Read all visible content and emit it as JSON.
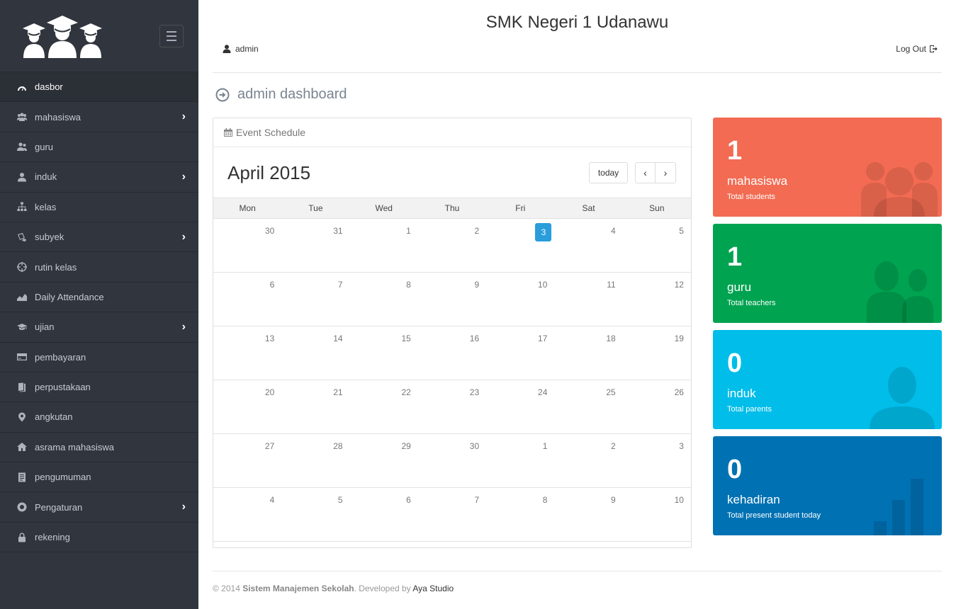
{
  "sidebar": {
    "items": [
      {
        "label": "dasbor",
        "icon": "dashboard-icon",
        "chevron": false,
        "active": true
      },
      {
        "label": "mahasiswa",
        "icon": "students-icon",
        "chevron": true
      },
      {
        "label": "guru",
        "icon": "teacher-icon",
        "chevron": false
      },
      {
        "label": "induk",
        "icon": "user-icon",
        "chevron": true
      },
      {
        "label": "kelas",
        "icon": "sitemap-icon",
        "chevron": false
      },
      {
        "label": "subyek",
        "icon": "book-tag-icon",
        "chevron": true
      },
      {
        "label": "rutin kelas",
        "icon": "crosshair-icon",
        "chevron": false
      },
      {
        "label": "Daily Attendance",
        "icon": "area-chart-icon",
        "chevron": false
      },
      {
        "label": "ujian",
        "icon": "graduation-cap-icon",
        "chevron": true
      },
      {
        "label": "pembayaran",
        "icon": "credit-card-icon",
        "chevron": false
      },
      {
        "label": "perpustakaan",
        "icon": "book-icon",
        "chevron": false
      },
      {
        "label": "angkutan",
        "icon": "map-marker-icon",
        "chevron": false
      },
      {
        "label": "asrama mahasiswa",
        "icon": "home-icon",
        "chevron": false
      },
      {
        "label": "pengumuman",
        "icon": "list-doc-icon",
        "chevron": false
      },
      {
        "label": "Pengaturan",
        "icon": "lifebuoy-icon",
        "chevron": true
      },
      {
        "label": "rekening",
        "icon": "lock-icon",
        "chevron": false
      }
    ],
    "chevron_glyph": "›"
  },
  "header": {
    "site_title": "SMK Negeri 1 Udanawu",
    "user": "admin",
    "logout": "Log Out"
  },
  "page": {
    "heading": "admin dashboard"
  },
  "calendar": {
    "panel_title": "Event Schedule",
    "month": "April 2015",
    "today_label": "today",
    "prev_label": "‹",
    "next_label": "›",
    "weekdays": [
      "Mon",
      "Tue",
      "Wed",
      "Thu",
      "Fri",
      "Sat",
      "Sun"
    ],
    "weeks": [
      [
        "30",
        "31",
        "1",
        "2",
        "3",
        "4",
        "5"
      ],
      [
        "6",
        "7",
        "8",
        "9",
        "10",
        "11",
        "12"
      ],
      [
        "13",
        "14",
        "15",
        "16",
        "17",
        "18",
        "19"
      ],
      [
        "20",
        "21",
        "22",
        "23",
        "24",
        "25",
        "26"
      ],
      [
        "27",
        "28",
        "29",
        "30",
        "1",
        "2",
        "3"
      ],
      [
        "4",
        "5",
        "6",
        "7",
        "8",
        "9",
        "10"
      ]
    ],
    "today": "3",
    "accent": "#2a9ddb"
  },
  "stats": {
    "students": {
      "value": "1",
      "label": "mahasiswa",
      "sub": "Total students",
      "color": "#f26b52"
    },
    "teachers": {
      "value": "1",
      "label": "guru",
      "sub": "Total teachers",
      "color": "#00a350"
    },
    "parents": {
      "value": "0",
      "label": "induk",
      "sub": "Total parents",
      "color": "#00bde9"
    },
    "attendance": {
      "value": "0",
      "label": "kehadiran",
      "sub": "Total present student today",
      "color": "#0071b3"
    }
  },
  "footer": {
    "copy": "© 2014 ",
    "brand": "Sistem Manajemen Sekolah",
    "middle": ". Developed by ",
    "developer": "Aya Studio"
  }
}
